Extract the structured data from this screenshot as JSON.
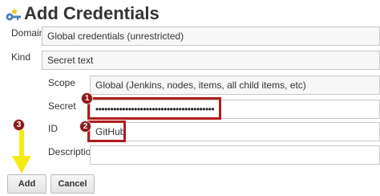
{
  "header": {
    "title": "Add Credentials"
  },
  "form": {
    "domain": {
      "label": "Domain",
      "value": "Global credentials (unrestricted)"
    },
    "kind": {
      "label": "Kind",
      "value": "Secret text"
    },
    "scope": {
      "label": "Scope",
      "value": "Global (Jenkins, nodes, items, all child items, etc)"
    },
    "secret": {
      "label": "Secret",
      "value": "••••••••••••••••••••••••••••••••••••••••"
    },
    "id": {
      "label": "ID",
      "value": "GitHub"
    },
    "description": {
      "label": "Description",
      "value": ""
    }
  },
  "annotations": {
    "badge_1": "1",
    "badge_2": "2",
    "badge_3": "3",
    "highlight_color": "#b01c1c",
    "arrow_color": "#f5ea14"
  },
  "buttons": {
    "add": "Add",
    "cancel": "Cancel"
  }
}
